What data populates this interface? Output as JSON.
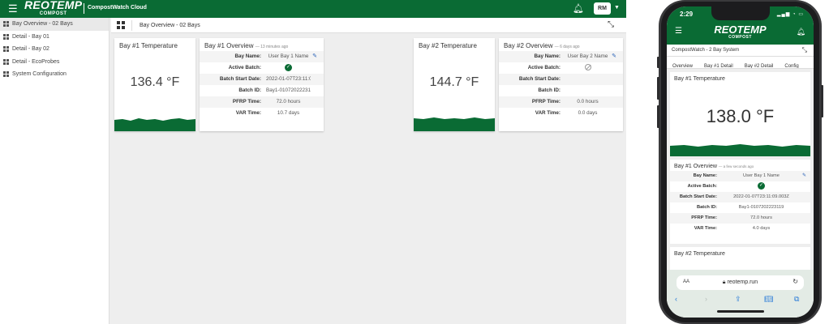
{
  "app": {
    "logo_text": "REOTEMP",
    "logo_sub": "COMPOST",
    "name": "CompostWatch Cloud",
    "user_initials": "RM"
  },
  "sidebar": {
    "items": [
      {
        "label": "Bay Overview - 02 Bays",
        "active": true
      },
      {
        "label": "Detail - Bay 01"
      },
      {
        "label": "Detail - Bay 02"
      },
      {
        "label": "Detail - EcoProbes"
      },
      {
        "label": "System Configuration"
      }
    ]
  },
  "breadcrumb": "Bay Overview - 02 Bays",
  "bay1": {
    "temp_title": "Bay #1 Temperature",
    "temp_value": "136.4 °F",
    "overview_title": "Bay #1 Overview",
    "overview_ago": "— 13 minutes ago",
    "rows": [
      {
        "key": "Bay Name:",
        "value": "User Bay 1 Name"
      },
      {
        "key": "Active Batch:",
        "value": ""
      },
      {
        "key": "Batch Start Date:",
        "value": "2022-01-07T23:11:09..."
      },
      {
        "key": "Batch ID:",
        "value": "Bay1-0107202223119"
      },
      {
        "key": "PFRP Time:",
        "value": "72.0 hours"
      },
      {
        "key": "VAR Time:",
        "value": "10.7 days"
      }
    ]
  },
  "bay2": {
    "temp_title": "Bay #2 Temperature",
    "temp_value": "144.7 °F",
    "overview_title": "Bay #2 Overview",
    "overview_ago": "— 6 days ago",
    "rows": [
      {
        "key": "Bay Name:",
        "value": "User Bay 2 Name"
      },
      {
        "key": "Active Batch:",
        "value": ""
      },
      {
        "key": "Batch Start Date:",
        "value": ""
      },
      {
        "key": "Batch ID:",
        "value": ""
      },
      {
        "key": "PFRP Time:",
        "value": "0.0 hours"
      },
      {
        "key": "VAR Time:",
        "value": "0.0 days"
      }
    ]
  },
  "phone": {
    "time": "2:29",
    "subtitle": "CompostWatch - 2 Bay System",
    "tabs": [
      "Overview",
      "Bay #1 Detail",
      "Bay #2 Detail",
      "Config"
    ],
    "bay1_temp_title": "Bay #1 Temperature",
    "bay1_temp_value": "138.0 °F",
    "bay1_overview_title": "Bay #1 Overview",
    "bay1_overview_ago": "— a few seconds ago",
    "rows": [
      {
        "key": "Bay Name:",
        "value": "User Bay 1 Name"
      },
      {
        "key": "Active Batch:",
        "value": ""
      },
      {
        "key": "Batch Start Date:",
        "value": "2022-01-07T23:11:09.003Z"
      },
      {
        "key": "Batch ID:",
        "value": "Bay1-0107202223119"
      },
      {
        "key": "PFRP Time:",
        "value": "72.0 hours"
      },
      {
        "key": "VAR Time:",
        "value": "4.0 days"
      }
    ],
    "bay2_temp_title": "Bay #2 Temperature",
    "safari_aa": "AA",
    "url": "reotemp.run"
  },
  "colors": {
    "brand_green": "#0a6b34",
    "link_blue": "#2a62b8"
  }
}
